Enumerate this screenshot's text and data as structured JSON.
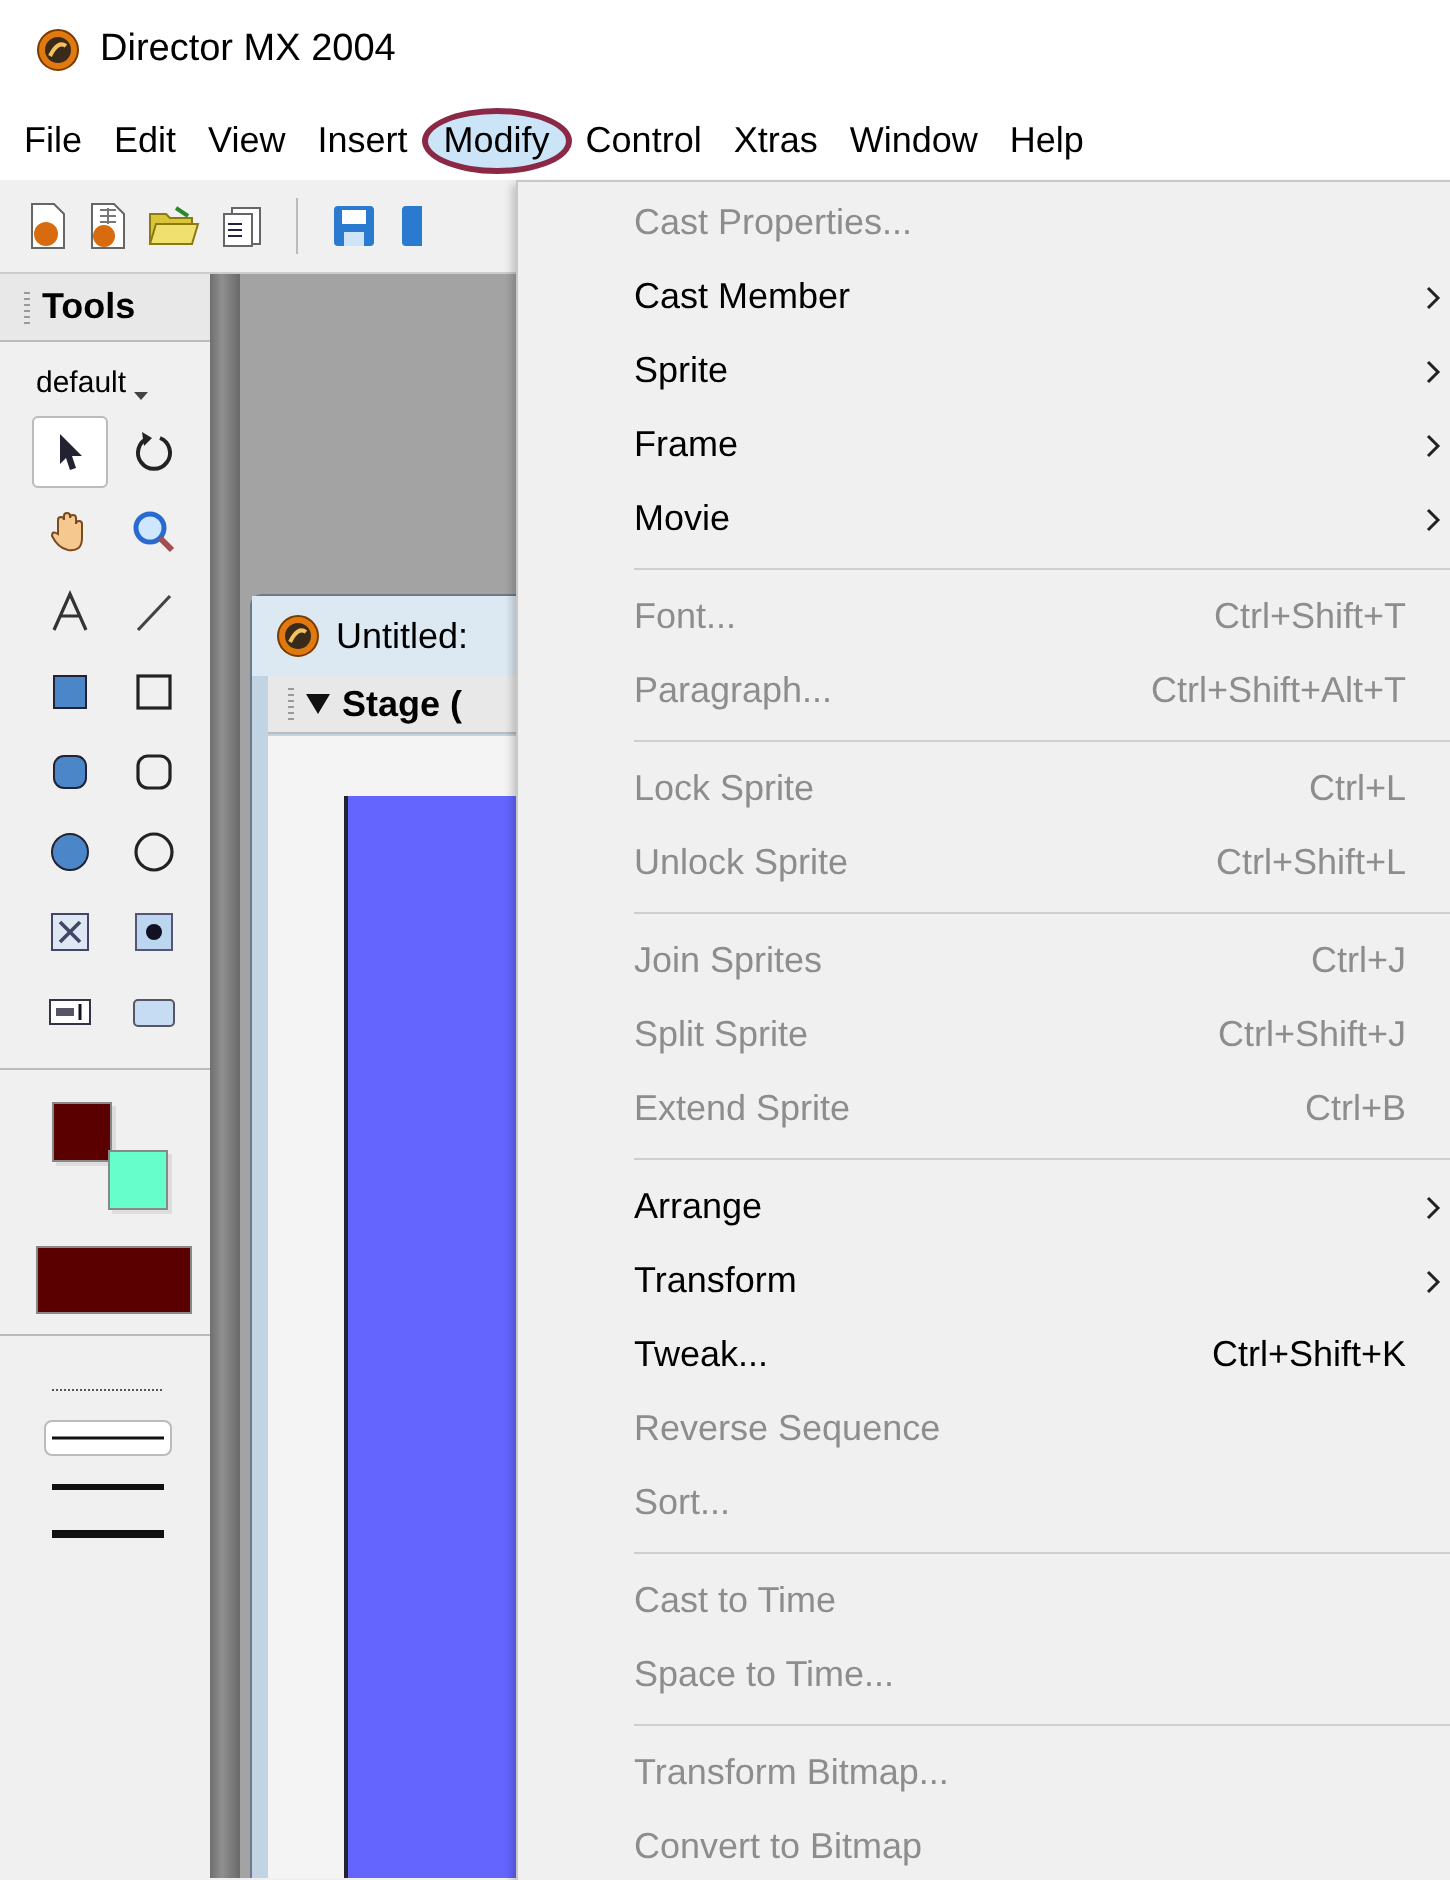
{
  "window": {
    "title": "Director MX 2004"
  },
  "menubar": [
    {
      "label": "File",
      "selected": false
    },
    {
      "label": "Edit",
      "selected": false
    },
    {
      "label": "View",
      "selected": false
    },
    {
      "label": "Insert",
      "selected": false
    },
    {
      "label": "Modify",
      "selected": true
    },
    {
      "label": "Control",
      "selected": false
    },
    {
      "label": "Xtras",
      "selected": false
    },
    {
      "label": "Window",
      "selected": false
    },
    {
      "label": "Help",
      "selected": false
    }
  ],
  "tools_panel": {
    "title": "Tools",
    "palette": "default",
    "tools": [
      {
        "kind": "arrow",
        "selected": true
      },
      {
        "kind": "rotate",
        "selected": false
      },
      {
        "kind": "hand",
        "selected": false
      },
      {
        "kind": "zoom",
        "selected": false
      },
      {
        "kind": "text",
        "selected": false
      },
      {
        "kind": "line",
        "selected": false
      },
      {
        "kind": "filled-rect",
        "selected": false
      },
      {
        "kind": "rect",
        "selected": false
      },
      {
        "kind": "filled-round-rect",
        "selected": false
      },
      {
        "kind": "round-rect",
        "selected": false
      },
      {
        "kind": "filled-ellipse",
        "selected": false
      },
      {
        "kind": "ellipse",
        "selected": false
      },
      {
        "kind": "checkbox",
        "selected": false
      },
      {
        "kind": "radio",
        "selected": false
      },
      {
        "kind": "field",
        "selected": false
      },
      {
        "kind": "push-button",
        "selected": false
      }
    ],
    "line_widths": [
      {
        "kind": "dotted",
        "selected": false
      },
      {
        "kind": "thin",
        "selected": true
      },
      {
        "kind": "medium",
        "selected": false
      },
      {
        "kind": "thick",
        "selected": false
      }
    ]
  },
  "stage_window": {
    "title": "Untitled:",
    "panel": "Stage ("
  },
  "menu": [
    {
      "kind": "item",
      "label": "Cast Properties...",
      "disabled": true
    },
    {
      "kind": "item",
      "label": "Cast Member",
      "disabled": false,
      "submenu": true
    },
    {
      "kind": "item",
      "label": "Sprite",
      "disabled": false,
      "submenu": true
    },
    {
      "kind": "item",
      "label": "Frame",
      "disabled": false,
      "submenu": true
    },
    {
      "kind": "item",
      "label": "Movie",
      "disabled": false,
      "submenu": true
    },
    {
      "kind": "separator"
    },
    {
      "kind": "item",
      "label": "Font...",
      "disabled": true,
      "shortcut": "Ctrl+Shift+T"
    },
    {
      "kind": "item",
      "label": "Paragraph...",
      "disabled": true,
      "shortcut": "Ctrl+Shift+Alt+T"
    },
    {
      "kind": "separator"
    },
    {
      "kind": "item",
      "label": "Lock Sprite",
      "disabled": true,
      "shortcut": "Ctrl+L"
    },
    {
      "kind": "item",
      "label": "Unlock Sprite",
      "disabled": true,
      "shortcut": "Ctrl+Shift+L"
    },
    {
      "kind": "separator"
    },
    {
      "kind": "item",
      "label": "Join Sprites",
      "disabled": true,
      "shortcut": "Ctrl+J"
    },
    {
      "kind": "item",
      "label": "Split Sprite",
      "disabled": true,
      "shortcut": "Ctrl+Shift+J"
    },
    {
      "kind": "item",
      "label": "Extend Sprite",
      "disabled": true,
      "shortcut": "Ctrl+B"
    },
    {
      "kind": "separator"
    },
    {
      "kind": "item",
      "label": "Arrange",
      "disabled": false,
      "submenu": true
    },
    {
      "kind": "item",
      "label": "Transform",
      "disabled": false,
      "submenu": true
    },
    {
      "kind": "item",
      "label": "Tweak...",
      "disabled": false,
      "shortcut": "Ctrl+Shift+K"
    },
    {
      "kind": "item",
      "label": "Reverse Sequence",
      "disabled": true
    },
    {
      "kind": "item",
      "label": "Sort...",
      "disabled": true
    },
    {
      "kind": "separator"
    },
    {
      "kind": "item",
      "label": "Cast to Time",
      "disabled": true
    },
    {
      "kind": "item",
      "label": "Space to Time...",
      "disabled": true
    },
    {
      "kind": "separator"
    },
    {
      "kind": "item",
      "label": "Transform Bitmap...",
      "disabled": true
    },
    {
      "kind": "item",
      "label": "Convert to Bitmap",
      "disabled": true
    }
  ]
}
